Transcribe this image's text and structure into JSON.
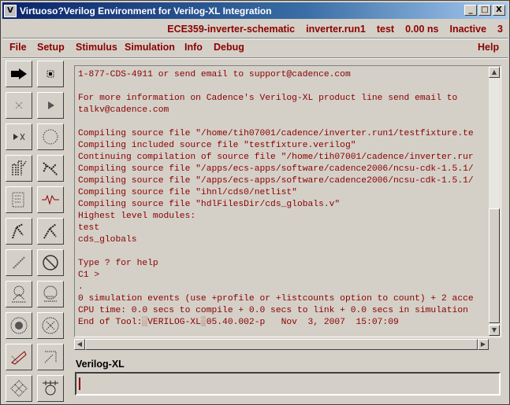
{
  "window": {
    "title": "Virtuoso?Verilog Environment for Verilog-XL Integration",
    "buttons": {
      "minimize": "_",
      "maximize": "□",
      "close": "X"
    }
  },
  "status": {
    "design": "ECE359-inverter-schematic",
    "run": "inverter.run1",
    "testbench": "test",
    "time": "0.00 ns",
    "state": "Inactive",
    "count": "3"
  },
  "menu": {
    "file": "File",
    "setup": "Setup",
    "stimulus": "Stimulus",
    "simulation": "Simulation",
    "info": "Info",
    "debug": "Debug",
    "help": "Help"
  },
  "tools": [
    {
      "name": "run-simulation-icon"
    },
    {
      "name": "stop-simulation-icon"
    },
    {
      "name": "pause-icon"
    },
    {
      "name": "continue-icon"
    },
    {
      "name": "step-icon"
    },
    {
      "name": "reset-icon"
    },
    {
      "name": "probe-icon"
    },
    {
      "name": "trace-icon"
    },
    {
      "name": "schematic-icon"
    },
    {
      "name": "waveform-icon"
    },
    {
      "name": "net-select-icon"
    },
    {
      "name": "net-deselect-icon"
    },
    {
      "name": "wire-icon"
    },
    {
      "name": "clear-probe-icon"
    },
    {
      "name": "hierarchy-icon"
    },
    {
      "name": "hierarchy-alt-icon"
    },
    {
      "name": "target-icon"
    },
    {
      "name": "target-clear-icon"
    },
    {
      "name": "edit-icon"
    },
    {
      "name": "edit-alt-icon"
    },
    {
      "name": "grid-icon"
    },
    {
      "name": "netlist-icon"
    }
  ],
  "output": {
    "lines": [
      "1-877-CDS-4911 or send email to support@cadence.com",
      "",
      "For more information on Cadence's Verilog-XL product line send email to",
      "talkv@cadence.com",
      "",
      "Compiling source file \"/home/tih07001/cadence/inverter.run1/testfixture.te",
      "Compiling included source file \"testfixture.verilog\"",
      "Continuing compilation of source file \"/home/tih07001/cadence/inverter.rur",
      "Compiling source file \"/apps/ecs-apps/software/cadence2006/ncsu-cdk-1.5.1/",
      "Compiling source file \"/apps/ecs-apps/software/cadence2006/ncsu-cdk-1.5.1/",
      "Compiling source file \"ihnl/cds0/netlist\"",
      "Compiling source file \"hdlFilesDir/cds_globals.v\"",
      "Highest level modules:",
      "test",
      "cds_globals",
      "",
      "Type ? for help",
      "C1 >",
      ".",
      "0 simulation events (use +profile or +listcounts option to count) + 2 acce",
      "CPU time: 0.0 secs to compile + 0.0 secs to link + 0.0 secs in simulation",
      "End of Tool:░VERILOG-XL░05.40.002-p   Nov  3, 2007  15:07:09"
    ]
  },
  "command": {
    "label": "Verilog-XL",
    "value": ""
  }
}
